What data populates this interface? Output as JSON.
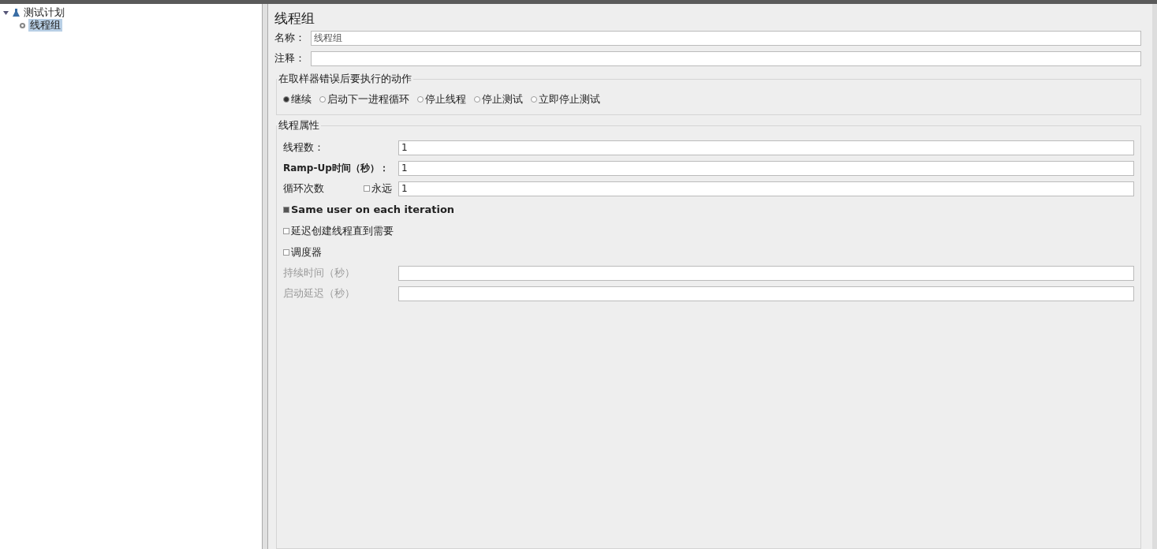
{
  "tree": [
    {
      "label": "测试计划",
      "expanded": true,
      "selected": false,
      "children": [
        {
          "label": "线程组",
          "selected": true
        }
      ]
    }
  ],
  "panel": {
    "title": "线程组",
    "name_field": {
      "label": "名称：",
      "value": "线程组"
    },
    "comment_field": {
      "label": "注释："
    },
    "error_action": {
      "title": "在取样器错误后要执行的动作",
      "options": [
        {
          "label": "继续",
          "selected": true
        },
        {
          "label": "启动下一进程循环",
          "selected": false
        },
        {
          "label": "停止线程",
          "selected": false
        },
        {
          "label": "停止测试",
          "selected": false
        },
        {
          "label": "立即停止测试",
          "selected": false
        }
      ]
    },
    "thread_properties": {
      "title": "线程属性",
      "threads": {
        "label": "线程数：",
        "value": "1"
      },
      "ramp_up": {
        "label": "Ramp-Up时间（秒）：",
        "value": "1"
      },
      "loop": {
        "label": "循环次数",
        "forever": {
          "label": "永远",
          "checked": false
        },
        "value": "1"
      },
      "checkboxes": [
        {
          "label": "Same user on each iteration",
          "checked": true,
          "bold": true
        },
        {
          "label": "延迟创建线程直到需要",
          "checked": false,
          "bold": false
        },
        {
          "label": "调度器",
          "checked": false,
          "bold": false
        }
      ],
      "scheduler_fields": [
        {
          "label": "持续时间（秒）",
          "disabled": true
        },
        {
          "label": "启动延迟（秒）",
          "disabled": true
        }
      ]
    }
  }
}
